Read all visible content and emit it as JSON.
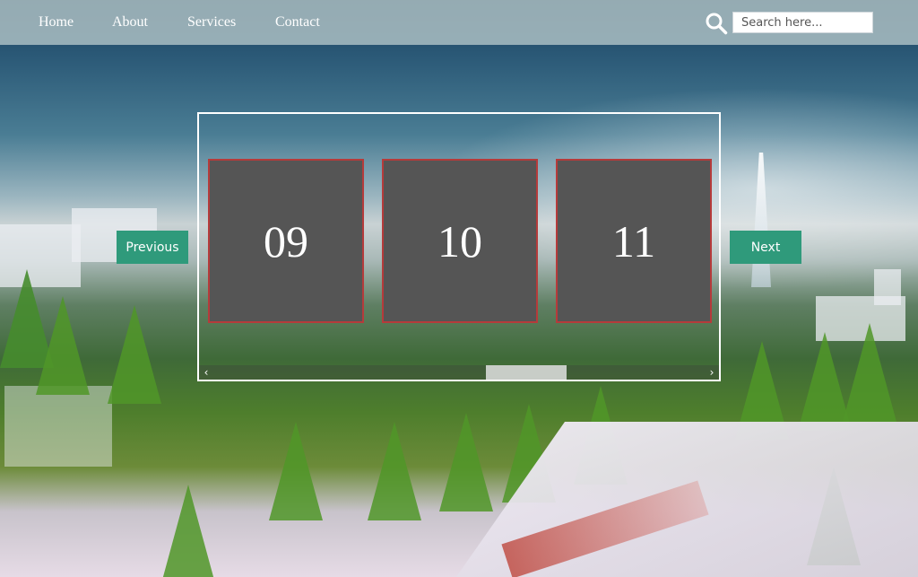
{
  "nav": {
    "links": [
      {
        "label": "Home"
      },
      {
        "label": "About"
      },
      {
        "label": "Services"
      },
      {
        "label": "Contact"
      }
    ]
  },
  "search": {
    "placeholder": "Search here...",
    "value": ""
  },
  "carousel": {
    "slides": [
      {
        "label": "09"
      },
      {
        "label": "10"
      },
      {
        "label": "11"
      }
    ],
    "previous_label": "Previous",
    "next_label": "Next",
    "scroll_left_glyph": "‹",
    "scroll_right_glyph": "›"
  },
  "colors": {
    "button": "#2f9a7b",
    "slide_bg": "#555555",
    "slide_border": "#b53b3b"
  },
  "icons": {
    "search": "search-icon"
  }
}
